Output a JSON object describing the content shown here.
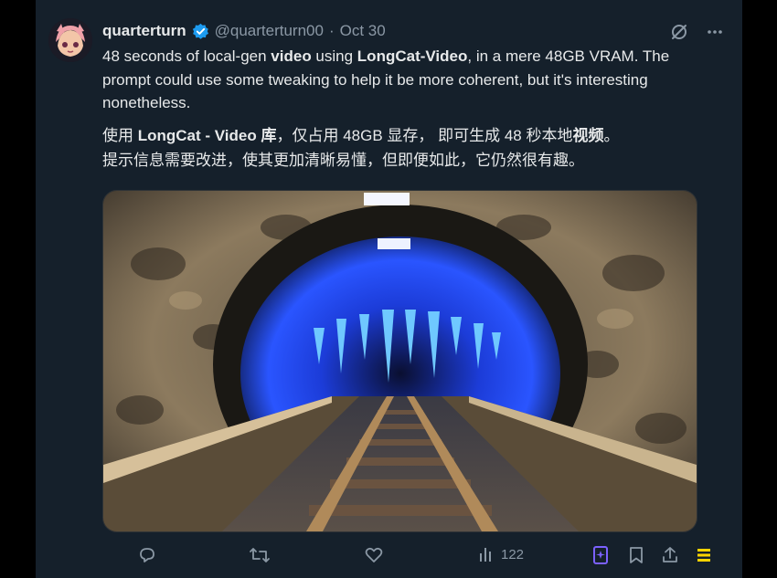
{
  "tweet": {
    "display_name": "quarterturn",
    "handle": "@quarterturn00",
    "separator": "·",
    "date": "Oct 30",
    "text_en": {
      "p1": "48 seconds of local-gen ",
      "b1": "video",
      "p2": " using ",
      "b2": "LongCat-Video",
      "p3": ", in a mere 48GB VRAM. The prompt could use some tweaking to help it be more coherent, but it's interesting nonetheless."
    },
    "text_zh": {
      "p1": "使用 ",
      "b1": "LongCat - Video 库",
      "p2": "，仅占用 48GB 显存， 即可生成 48 秒本地",
      "b2": "视频",
      "p3": "。",
      "line2": "提示信息需要改进，使其更加清晰易懂，但即便如此，它仍然很有趣。"
    },
    "views": "122"
  },
  "colors": {
    "background": "#15202b",
    "text": "#e7e9ea",
    "muted": "#8b98a5",
    "verified": "#1d9bf0",
    "grok_purple": "#7b61ff",
    "premium_gold": "#ffd400"
  },
  "icons": [
    "verified-icon",
    "grok-icon",
    "more-icon",
    "reply-icon",
    "retweet-icon",
    "like-icon",
    "views-icon",
    "grok-explain-icon",
    "bookmark-icon",
    "share-icon",
    "premium-icon"
  ]
}
